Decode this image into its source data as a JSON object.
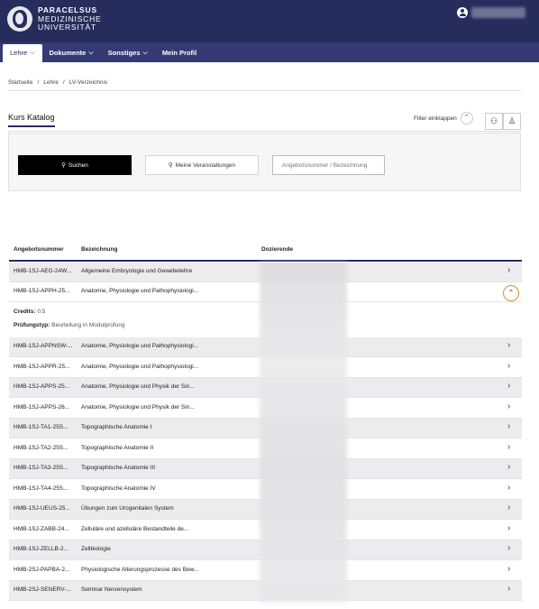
{
  "header": {
    "logo_line1": "PARACELSUS",
    "logo_line2": "MEDIZINISCHE",
    "logo_line3": "UNIVERSITÄT"
  },
  "nav": {
    "items": [
      {
        "label": "Lehre",
        "chevron": "⌵",
        "active": true
      },
      {
        "label": "Dokumente",
        "chevron": "⌵"
      },
      {
        "label": "Sonstiges",
        "chevron": "⌵"
      },
      {
        "label": "Mein Profil"
      }
    ]
  },
  "breadcrumb": [
    "Startseite",
    "/",
    "Lehre",
    "/",
    "LV-Verzeichnis"
  ],
  "catalog": {
    "title": "Kurs Katalog",
    "filter_label": "Filter einklappen"
  },
  "search": {
    "search_button": "Suchen",
    "mine_button": "Meine Veranstaltungen",
    "input_placeholder": "Angebotsnummer / Bezeichnung"
  },
  "table": {
    "headers": [
      "Angebotsnummer",
      "Bezeichnung",
      "Dozierende"
    ],
    "rows": [
      {
        "id": "HMB-1SJ-AEG-24W...",
        "name": "Allgemeine Embryologie und Gewebelehre"
      },
      {
        "id": "HMB-1SJ-APPH-25...",
        "name": "Anatomie, Physiologie und Pathophysiologi..."
      },
      {
        "id": "HMB-1SJ-APPNSW-...",
        "name": "Anatomie, Physiologie und Pathophysiologi..."
      },
      {
        "id": "HMB-1SJ-APPR-25...",
        "name": "Anatomie, Physiologie und Pathophysiologi..."
      },
      {
        "id": "HMB-1SJ-APPS-25...",
        "name": "Anatomie, Physiologie und Physik der Sin..."
      },
      {
        "id": "HMB-1SJ-APPS-26...",
        "name": "Anatomie, Physiologie und Physik der Sin..."
      },
      {
        "id": "HMB-1SJ-TA1-25S...",
        "name": "Topographische Anatomie I"
      },
      {
        "id": "HMB-1SJ-TA2-25S...",
        "name": "Topographische Anatomie II"
      },
      {
        "id": "HMB-1SJ-TA3-25S...",
        "name": "Topographische Anatomie III"
      },
      {
        "id": "HMB-1SJ-TA4-25S...",
        "name": "Topographische Anatomie IV"
      },
      {
        "id": "HMB-1SJ-UEUS-25...",
        "name": "Übungen zum Urogenitalen System"
      },
      {
        "id": "HMB-1SJ-ZABB-24...",
        "name": "Zelluläre und azelluläre Bestandteile de..."
      },
      {
        "id": "HMB-1SJ-ZELLB-2...",
        "name": "Zellbiologie"
      },
      {
        "id": "HMB-2SJ-PAPBA-2...",
        "name": "Physiologische Alterungsprozesse des Bew..."
      },
      {
        "id": "HMB-2SJ-SENERV-...",
        "name": "Seminar Nervensystem"
      }
    ],
    "expanded": {
      "credits_label": "Credits:",
      "credits_value": "0.5",
      "exam_label": "Prüfungstyp:",
      "exam_value": "Beurteilung in Modulprüfung"
    }
  }
}
